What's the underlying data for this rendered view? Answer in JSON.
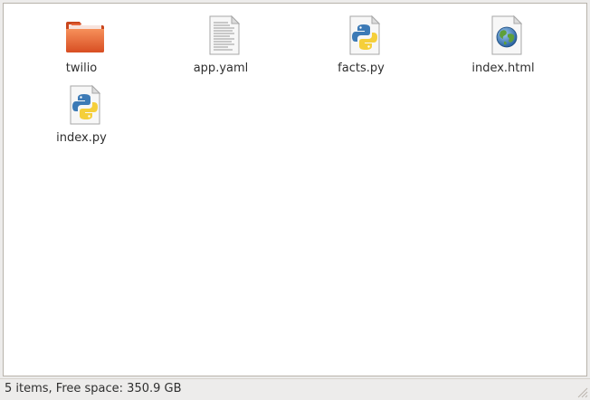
{
  "files": [
    {
      "label": "twilio",
      "icon": "folder-icon"
    },
    {
      "label": "app.yaml",
      "icon": "text-file-icon"
    },
    {
      "label": "facts.py",
      "icon": "python-file-icon"
    },
    {
      "label": "index.html",
      "icon": "html-file-icon"
    },
    {
      "label": "index.py",
      "icon": "python-file-icon"
    }
  ],
  "status": {
    "text": "5 items, Free space: 350.9 GB"
  },
  "colors": {
    "folder": "#e8643a",
    "background": "#ffffff",
    "chrome": "#edeceb"
  }
}
